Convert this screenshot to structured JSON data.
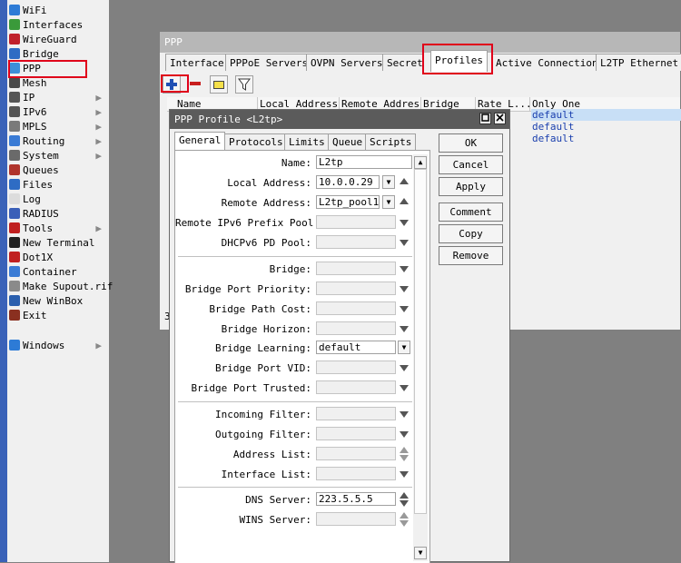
{
  "sidebar": {
    "items": [
      {
        "label": "WiFi",
        "icon": "wifi-icon",
        "color": "#2d7bd6",
        "submenu": false
      },
      {
        "label": "Interfaces",
        "icon": "interfaces-icon",
        "color": "#3a9a3a",
        "submenu": false
      },
      {
        "label": "WireGuard",
        "icon": "wireguard-icon",
        "color": "#c0202a",
        "submenu": false
      },
      {
        "label": "Bridge",
        "icon": "bridge-icon",
        "color": "#2e6cc4",
        "submenu": false
      },
      {
        "label": "PPP",
        "icon": "ppp-icon",
        "color": "#3d8fd8",
        "submenu": false
      },
      {
        "label": "Mesh",
        "icon": "mesh-icon",
        "color": "#4a4a4a",
        "submenu": false
      },
      {
        "label": "IP",
        "icon": "ip-icon",
        "color": "#555555",
        "submenu": true
      },
      {
        "label": "IPv6",
        "icon": "ipv6-icon",
        "color": "#555555",
        "submenu": true
      },
      {
        "label": "MPLS",
        "icon": "mpls-icon",
        "color": "#7a7a7a",
        "submenu": true
      },
      {
        "label": "Routing",
        "icon": "routing-icon",
        "color": "#3a7bd5",
        "submenu": true
      },
      {
        "label": "System",
        "icon": "system-icon",
        "color": "#6a6a6a",
        "submenu": true
      },
      {
        "label": "Queues",
        "icon": "queues-icon",
        "color": "#b0342c",
        "submenu": false
      },
      {
        "label": "Files",
        "icon": "files-icon",
        "color": "#2e6cc4",
        "submenu": false
      },
      {
        "label": "Log",
        "icon": "log-icon",
        "color": "#dcdcdc",
        "submenu": false
      },
      {
        "label": "RADIUS",
        "icon": "radius-icon",
        "color": "#3a5fb8",
        "submenu": false
      },
      {
        "label": "Tools",
        "icon": "tools-icon",
        "color": "#c02020",
        "submenu": true
      },
      {
        "label": "New Terminal",
        "icon": "terminal-icon",
        "color": "#222222",
        "submenu": false
      },
      {
        "label": "Dot1X",
        "icon": "dot1x-icon",
        "color": "#c02020",
        "submenu": false
      },
      {
        "label": "Container",
        "icon": "container-icon",
        "color": "#3a7bd5",
        "submenu": false
      },
      {
        "label": "Make Supout.rif",
        "icon": "supout-icon",
        "color": "#8a8a8a",
        "submenu": false
      },
      {
        "label": "New WinBox",
        "icon": "winbox-icon",
        "color": "#2a5fae",
        "submenu": false
      },
      {
        "label": "Exit",
        "icon": "exit-icon",
        "color": "#8a3020",
        "submenu": false
      },
      {
        "label": "Windows",
        "icon": "windows-icon",
        "color": "#2d7bd6",
        "submenu": true
      }
    ]
  },
  "ppp_window": {
    "title": "PPP",
    "tabs": [
      "Interface",
      "PPPoE Servers",
      "OVPN Servers",
      "Secrets",
      "Profiles",
      "Active Connections",
      "L2TP Ethernet"
    ],
    "active_tab": "Profiles",
    "toolbar": [
      "add",
      "remove",
      "comment",
      "filter"
    ],
    "columns": [
      "Name",
      "Local Address",
      "Remote Address",
      "Bridge",
      "Rate L...",
      "Only One"
    ],
    "only_one_values": [
      "default",
      "default",
      "default"
    ],
    "footer_count": "3"
  },
  "profile_dialog": {
    "title": "PPP Profile <L2tp>",
    "tabs": [
      "General",
      "Protocols",
      "Limits",
      "Queue",
      "Scripts"
    ],
    "active_tab": "General",
    "fields": {
      "name": {
        "label": "Name:",
        "value": "L2tp"
      },
      "local_address": {
        "label": "Local Address:",
        "value": "10.0.0.29"
      },
      "remote_address": {
        "label": "Remote Address:",
        "value": "L2tp_pool1"
      },
      "remote_ipv6_prefix_pool": {
        "label": "Remote IPv6 Prefix Pool:",
        "value": ""
      },
      "dhcpv6_pd_pool": {
        "label": "DHCPv6 PD Pool:",
        "value": ""
      },
      "bridge": {
        "label": "Bridge:",
        "value": ""
      },
      "bridge_port_priority": {
        "label": "Bridge Port Priority:",
        "value": ""
      },
      "bridge_path_cost": {
        "label": "Bridge Path Cost:",
        "value": ""
      },
      "bridge_horizon": {
        "label": "Bridge Horizon:",
        "value": ""
      },
      "bridge_learning": {
        "label": "Bridge Learning:",
        "value": "default"
      },
      "bridge_port_vid": {
        "label": "Bridge Port VID:",
        "value": ""
      },
      "bridge_port_trusted": {
        "label": "Bridge Port Trusted:",
        "value": ""
      },
      "incoming_filter": {
        "label": "Incoming Filter:",
        "value": ""
      },
      "outgoing_filter": {
        "label": "Outgoing Filter:",
        "value": ""
      },
      "address_list": {
        "label": "Address List:",
        "value": ""
      },
      "interface_list": {
        "label": "Interface List:",
        "value": ""
      },
      "dns_server": {
        "label": "DNS Server:",
        "value": "223.5.5.5"
      },
      "wins_server": {
        "label": "WINS Server:",
        "value": ""
      }
    },
    "buttons": {
      "ok": "OK",
      "cancel": "Cancel",
      "apply": "Apply",
      "comment": "Comment",
      "copy": "Copy",
      "remove": "Remove"
    }
  },
  "colors": {
    "highlight": "#e0001a",
    "selected_row": "#c8dff6",
    "link_text": "#1a3fae"
  }
}
